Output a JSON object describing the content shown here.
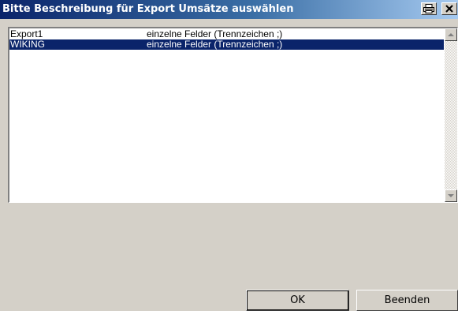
{
  "window": {
    "title": "Bitte Beschreibung für Export Umsätze auswählen"
  },
  "titlebar_buttons": {
    "print_icon": "printer-icon",
    "close_icon": "close-icon",
    "close_label": "X"
  },
  "list": {
    "items": [
      {
        "name": "Export1",
        "format": "einzelne Felder (Trennzeichen ;)",
        "selected": false
      },
      {
        "name": "WIKING",
        "format": "einzelne Felder (Trennzeichen ;)",
        "selected": true
      }
    ]
  },
  "buttons": {
    "ok_label": "OK",
    "beenden_label": "Beenden"
  },
  "colors": {
    "titlebar": "#0a246a",
    "selection": "#0a246a",
    "face": "#d4d0c8"
  }
}
